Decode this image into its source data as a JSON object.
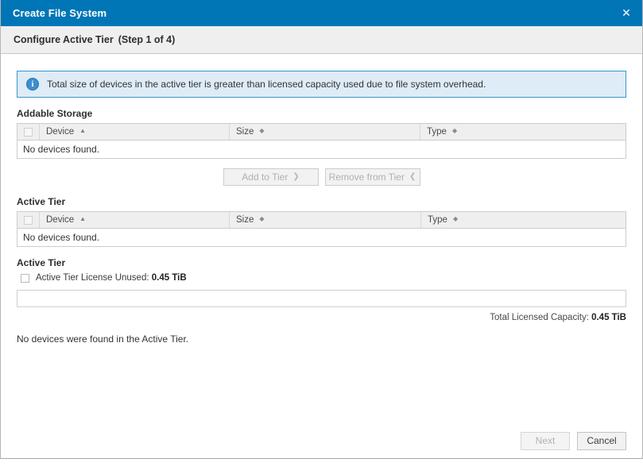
{
  "window": {
    "title": "Create File System",
    "close_icon": "close-icon"
  },
  "step": {
    "title": "Configure Active Tier",
    "counter": "(Step 1 of 4)"
  },
  "info_banner": {
    "icon": "info-circle-icon",
    "message": "Total size of devices in the active tier is greater than licensed capacity used due to file system overhead."
  },
  "addable_storage": {
    "label": "Addable Storage",
    "columns": [
      {
        "label": "Device",
        "sort": "ascending",
        "sort_glyph": "▲"
      },
      {
        "label": "Size",
        "sort": "none",
        "sort_glyph": "◆"
      },
      {
        "label": "Type",
        "sort": "none",
        "sort_glyph": "◆"
      }
    ],
    "rows": [],
    "empty_message": "No devices found."
  },
  "tier_actions": {
    "add": {
      "label": "Add to Tier",
      "icon": "chevron-double-down-icon",
      "glyph": "ˇ",
      "disabled": true
    },
    "remove": {
      "label": "Remove from Tier",
      "icon": "chevron-double-up-icon",
      "glyph": "ˆ",
      "disabled": true
    }
  },
  "active_tier_table": {
    "label": "Active Tier",
    "columns": [
      {
        "label": "Device",
        "sort": "ascending",
        "sort_glyph": "▲"
      },
      {
        "label": "Size",
        "sort": "none",
        "sort_glyph": "◆"
      },
      {
        "label": "Type",
        "sort": "none",
        "sort_glyph": "◆"
      }
    ],
    "rows": [],
    "empty_message": "No devices found."
  },
  "capacity": {
    "label": "Active Tier",
    "legend_label": "Active Tier License Unused:",
    "legend_value": "0.45 TiB",
    "bar_segments": [],
    "total_label": "Total Licensed Capacity:",
    "total_value": "0.45 TiB"
  },
  "note": "No devices were found in the Active Tier.",
  "footer": {
    "next": {
      "label": "Next",
      "disabled": true
    },
    "cancel": {
      "label": "Cancel",
      "disabled": false
    }
  },
  "colors": {
    "title_bar": "#0076b6",
    "info_bg": "#ddecf6",
    "info_border": "#3b96cd",
    "step_bar": "#efefef"
  }
}
